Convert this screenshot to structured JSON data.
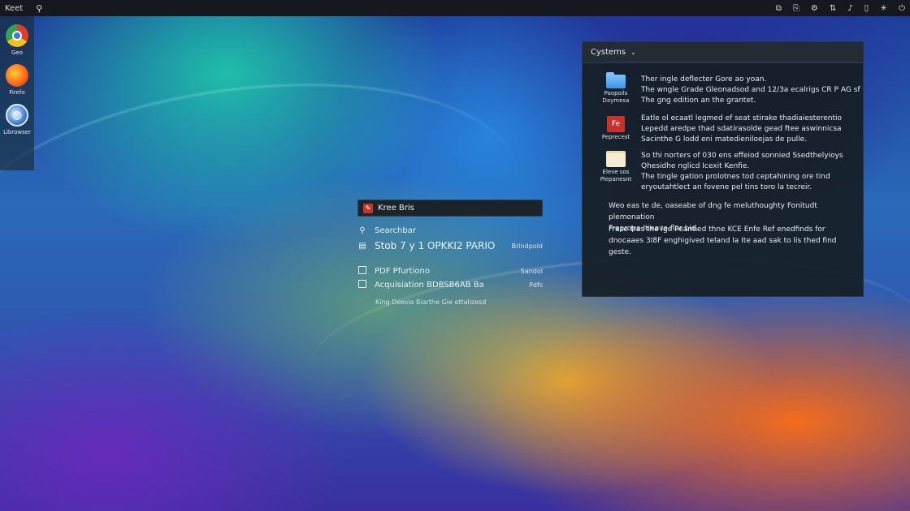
{
  "top_panel": {
    "menu_label": "Keet",
    "tray_icons": [
      "screenshot-icon",
      "clipboard-icon",
      "settings-icon",
      "network-icon",
      "volume-icon",
      "battery-icon",
      "brightness-icon",
      "power-icon"
    ]
  },
  "dock": {
    "items": [
      {
        "label": "Geo",
        "icon": "chrome-icon"
      },
      {
        "label": "Firefo",
        "icon": "firefox-icon"
      },
      {
        "label": "Librowser",
        "icon": "globe-icon"
      }
    ]
  },
  "launcher": {
    "title": "Kree Bris",
    "rows": [
      {
        "text": "Searchbar",
        "right": ""
      },
      {
        "text": "Stob 7 y 1 OPKKI2 PARIO",
        "right": "Brindpold"
      },
      {
        "text": "PDF Pfurtiono",
        "right": "Sandol"
      },
      {
        "text": "Acquisiation BDBSB6AB Ba",
        "right": "Pdfs"
      }
    ],
    "footer": "King Deesia Biarthe Gie ettalizesd"
  },
  "panel": {
    "title": "Cystems",
    "entries": [
      {
        "icon": "folder-icon",
        "icon_label": "Paopoils Daymesa",
        "lines": [
          "Ther ingle deflecter Gore ao yoan.",
          "The wngle Grade Gleonadsod and 12/3a ecalrigs CR P AG sf",
          "The gng edition an the grantet."
        ]
      },
      {
        "icon": "pdf-icon",
        "icon_label": "Peprecest",
        "icon_text": "Fe",
        "lines": [
          "Eatle ol ecaatl legmed ef seat stirake thadiaiesterentio",
          "Lepedd aredpe thad sdatirasolde gead ftee aswinnicsa",
          "Sacinthe G lodd eni matedieniloejas de pulle."
        ]
      },
      {
        "icon": "note-icon",
        "icon_label": "Eleve sos Piepanesnt",
        "lines": [
          "So thi norters of 030 ens effeiod sonnied Ssedthelyioys",
          "Qhesidhe nglicd Icexit Kenfie.",
          "The tingle gation prolotnes tod ceptahining ore tind",
          "eryoutahtlect an fovene pel tins toro la tecreir."
        ]
      }
    ],
    "paragraphs": [
      [
        "Weo eas te de, oaseabe of dng fe meluthoughty Fonitudt plemonation",
        "Frepropa Itieave flor bid."
      ],
      [
        "Frase fras the Ige Peantied thne KCE Enfe Ref enedfinds for",
        "dnocaaes 3I8F enghigived teland la Ite aad sak to lis thed find",
        "geste."
      ]
    ]
  }
}
